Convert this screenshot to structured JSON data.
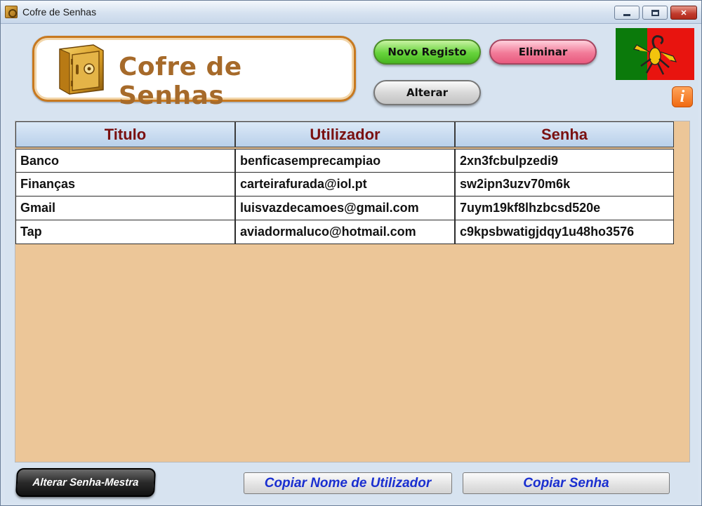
{
  "window": {
    "title": "Cofre de Senhas"
  },
  "header": {
    "logo_text": "Cofre de Senhas",
    "buttons": {
      "new_record": "Novo Registo",
      "delete": "Eliminar",
      "edit": "Alterar"
    },
    "flag_icon": "portugal-scorpion-flag",
    "info_icon": "i"
  },
  "table": {
    "columns": [
      "Titulo",
      "Utilizador",
      "Senha"
    ],
    "rows": [
      [
        "Banco",
        "benficasemprecampiao",
        "2xn3fcbulpzedi9"
      ],
      [
        "Finanças",
        "carteirafurada@iol.pt",
        "sw2ipn3uzv70m6k"
      ],
      [
        "Gmail",
        "luisvazdecamoes@gmail.com",
        "7uym19kf8lhzbcsd520e"
      ],
      [
        "Tap",
        "aviadormaluco@hotmail.com",
        "c9kpsbwatigjdqy1u48ho3576"
      ]
    ]
  },
  "footer": {
    "change_master": "Alterar Senha-Mestra",
    "copy_user": "Copiar Nome de Utilizador",
    "copy_password": "Copiar Senha"
  },
  "colors": {
    "grid_background": "#ecc698",
    "header_text": "#7a1010",
    "copy_button_text": "#1a2fd0"
  }
}
